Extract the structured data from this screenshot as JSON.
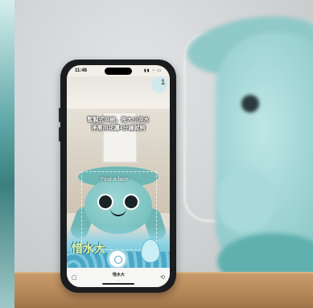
{
  "phone": {
    "status_time": "11:48",
    "status_icons": "▮▮ ◔ ▭",
    "count_badge": "1",
    "caption": "暫製式沖刷，按大小沖水\n淨擦用花灑4分鐘就夠",
    "overlay_text": "Find a face",
    "title_art": "惜水大",
    "bottom_title": "惜水大",
    "bottom_url": "...",
    "bottom_left_icon": "▢",
    "bottom_right_icon": "⟲"
  }
}
